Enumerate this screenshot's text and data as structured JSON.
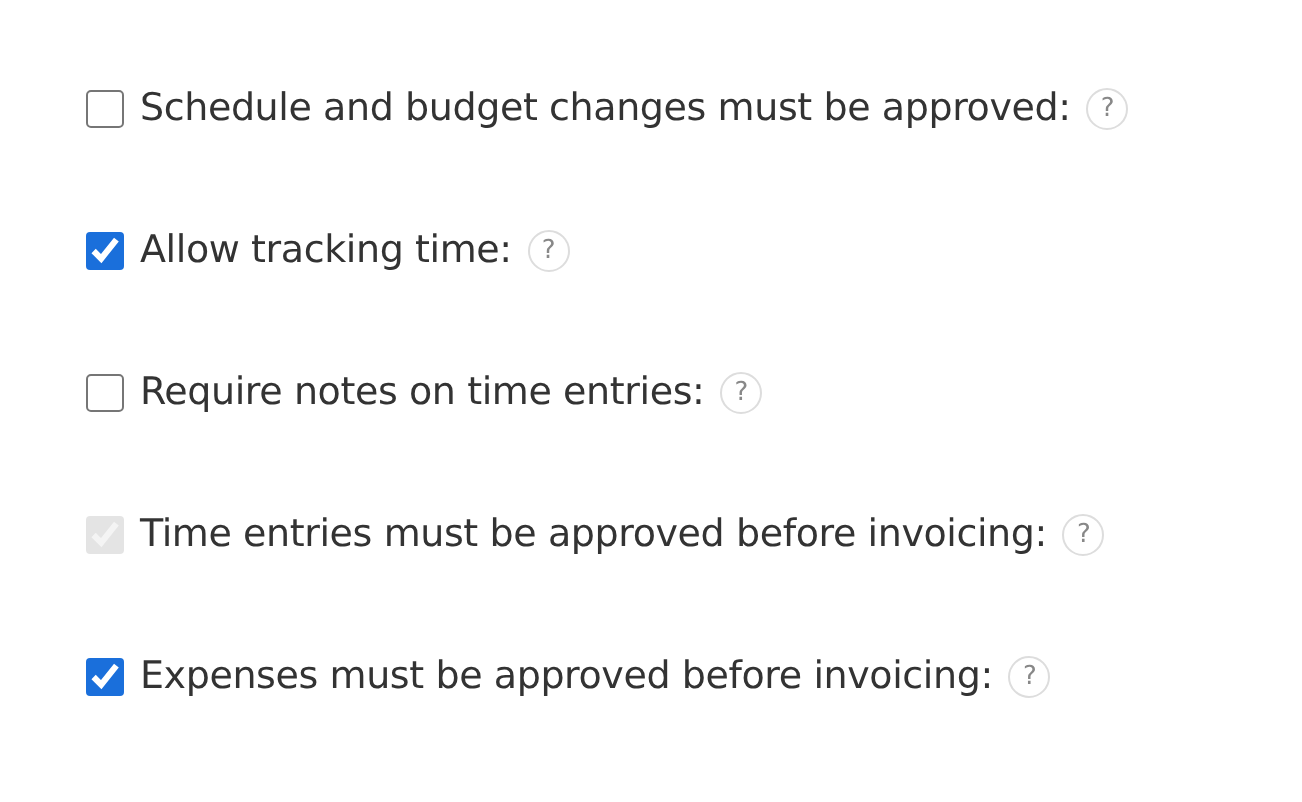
{
  "options": [
    {
      "label": "Schedule and budget changes must be approved:",
      "checked": false,
      "disabled": false,
      "help": "?"
    },
    {
      "label": "Allow tracking time:",
      "checked": true,
      "disabled": false,
      "help": "?"
    },
    {
      "label": "Require notes on time entries:",
      "checked": false,
      "disabled": false,
      "help": "?"
    },
    {
      "label": "Time entries must be approved before invoicing:",
      "checked": true,
      "disabled": true,
      "help": "?"
    },
    {
      "label": "Expenses must be approved before invoicing:",
      "checked": true,
      "disabled": false,
      "help": "?"
    }
  ]
}
